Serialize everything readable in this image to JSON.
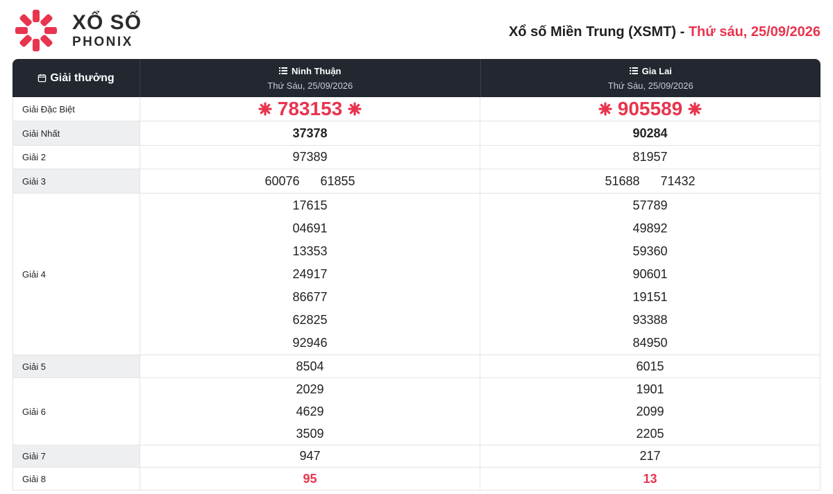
{
  "brand": {
    "line1": "XỔ SỐ",
    "line2": "PHONIX",
    "accent": "#e8344e"
  },
  "header": {
    "title": "Xổ số Miền Trung (XSMT) - ",
    "date": "Thứ sáu, 25/09/2026"
  },
  "table": {
    "prize_header": "Giải thưởng",
    "columns": [
      {
        "name": "Ninh Thuận",
        "date": "Thứ Sáu, 25/09/2026"
      },
      {
        "name": "Gia Lai",
        "date": "Thứ Sáu, 25/09/2026"
      }
    ],
    "rows": [
      {
        "label": "Giải Đặc Biệt",
        "values": [
          [
            "783153"
          ],
          [
            "905589"
          ]
        ]
      },
      {
        "label": "Giải Nhất",
        "values": [
          [
            "37378"
          ],
          [
            "90284"
          ]
        ]
      },
      {
        "label": "Giải 2",
        "values": [
          [
            "97389"
          ],
          [
            "81957"
          ]
        ]
      },
      {
        "label": "Giải 3",
        "values": [
          [
            "60076",
            "61855"
          ],
          [
            "51688",
            "71432"
          ]
        ]
      },
      {
        "label": "Giải 4",
        "values": [
          [
            "17615",
            "04691",
            "13353",
            "24917",
            "86677",
            "62825",
            "92946"
          ],
          [
            "57789",
            "49892",
            "59360",
            "90601",
            "19151",
            "93388",
            "84950"
          ]
        ]
      },
      {
        "label": "Giải 5",
        "values": [
          [
            "8504"
          ],
          [
            "6015"
          ]
        ]
      },
      {
        "label": "Giải 6",
        "values": [
          [
            "2029",
            "4629",
            "3509"
          ],
          [
            "1901",
            "2099",
            "2205"
          ]
        ]
      },
      {
        "label": "Giải 7",
        "values": [
          [
            "947"
          ],
          [
            "217"
          ]
        ]
      },
      {
        "label": "Giải 8",
        "values": [
          [
            "95"
          ],
          [
            "13"
          ]
        ]
      }
    ]
  }
}
